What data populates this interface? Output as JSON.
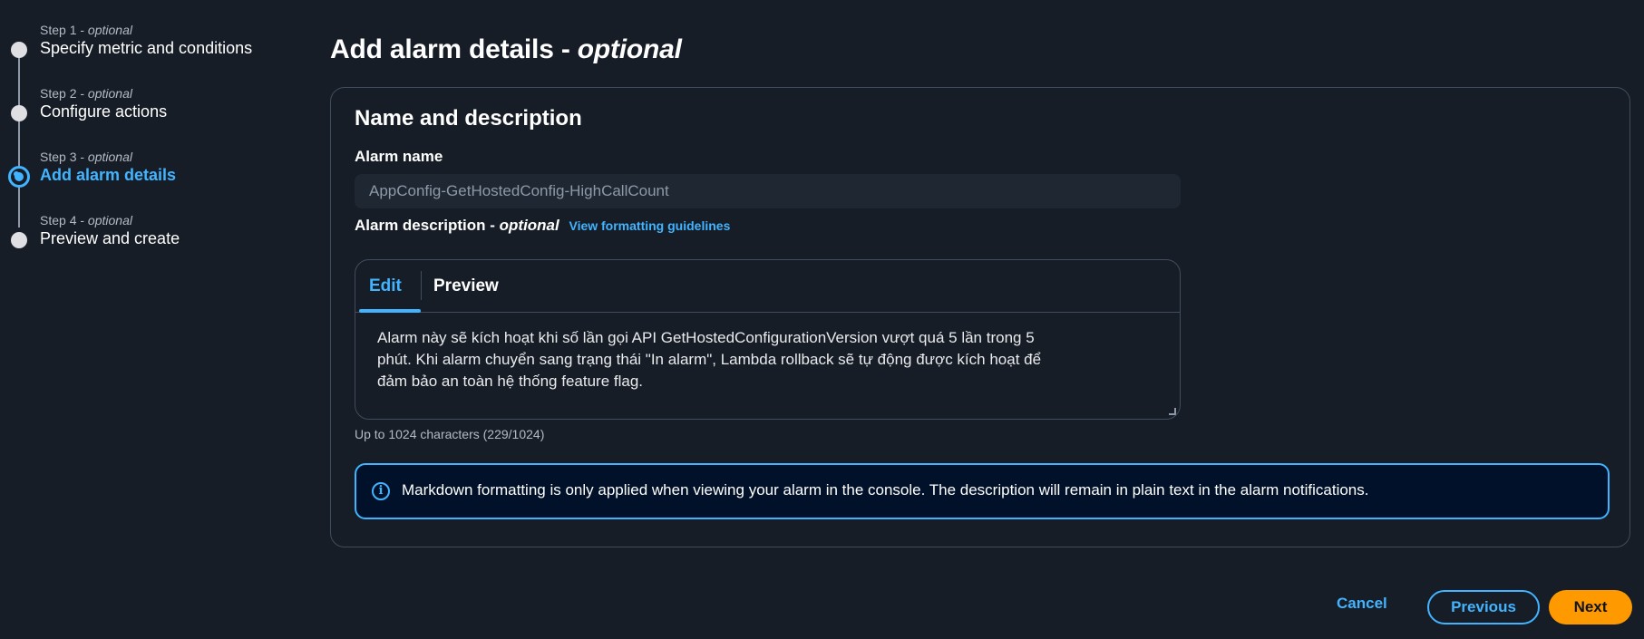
{
  "wizard": {
    "optional_text": "optional",
    "steps": [
      {
        "kicker_prefix": "Step 1 - ",
        "title": "Specify metric and conditions",
        "state": "done"
      },
      {
        "kicker_prefix": "Step 2 - ",
        "title": "Configure actions",
        "state": "done"
      },
      {
        "kicker_prefix": "Step 3 - ",
        "title": "Add alarm details",
        "state": "active"
      },
      {
        "kicker_prefix": "Step 4 - ",
        "title": "Preview and create",
        "state": "upcoming"
      }
    ]
  },
  "page": {
    "title_prefix": "Add alarm details - ",
    "title_optional": "optional"
  },
  "name_section": {
    "title": "Name and description",
    "alarm_name_label": "Alarm name",
    "alarm_name_value": "AppConfig-GetHostedConfig-HighCallCount",
    "description_label_prefix": "Alarm description - ",
    "description_label_optional": "optional",
    "guidelines_link": "View formatting guidelines",
    "tabs": {
      "edit": "Edit",
      "preview": "Preview"
    },
    "description_value": "Alarm này sẽ kích hoạt khi số lần gọi API GetHostedConfigurationVersion vượt quá 5 lần trong 5 phút. Khi alarm chuyển sang trạng thái \"In alarm\", Lambda rollback sẽ tự động được kích hoạt để đảm bảo an toàn hệ thống feature flag.",
    "char_count": "Up to 1024 characters (229/1024)",
    "info_text": "Markdown formatting is only applied when viewing your alarm in the console. The description will remain in plain text in the alarm notifications.",
    "info_icon": "info-icon"
  },
  "footer": {
    "cancel_label": "Cancel",
    "previous_label": "Previous",
    "next_label": "Next"
  },
  "colors": {
    "background": "#161d26",
    "accent": "#42b4ff",
    "primary_button": "#ff9900"
  }
}
